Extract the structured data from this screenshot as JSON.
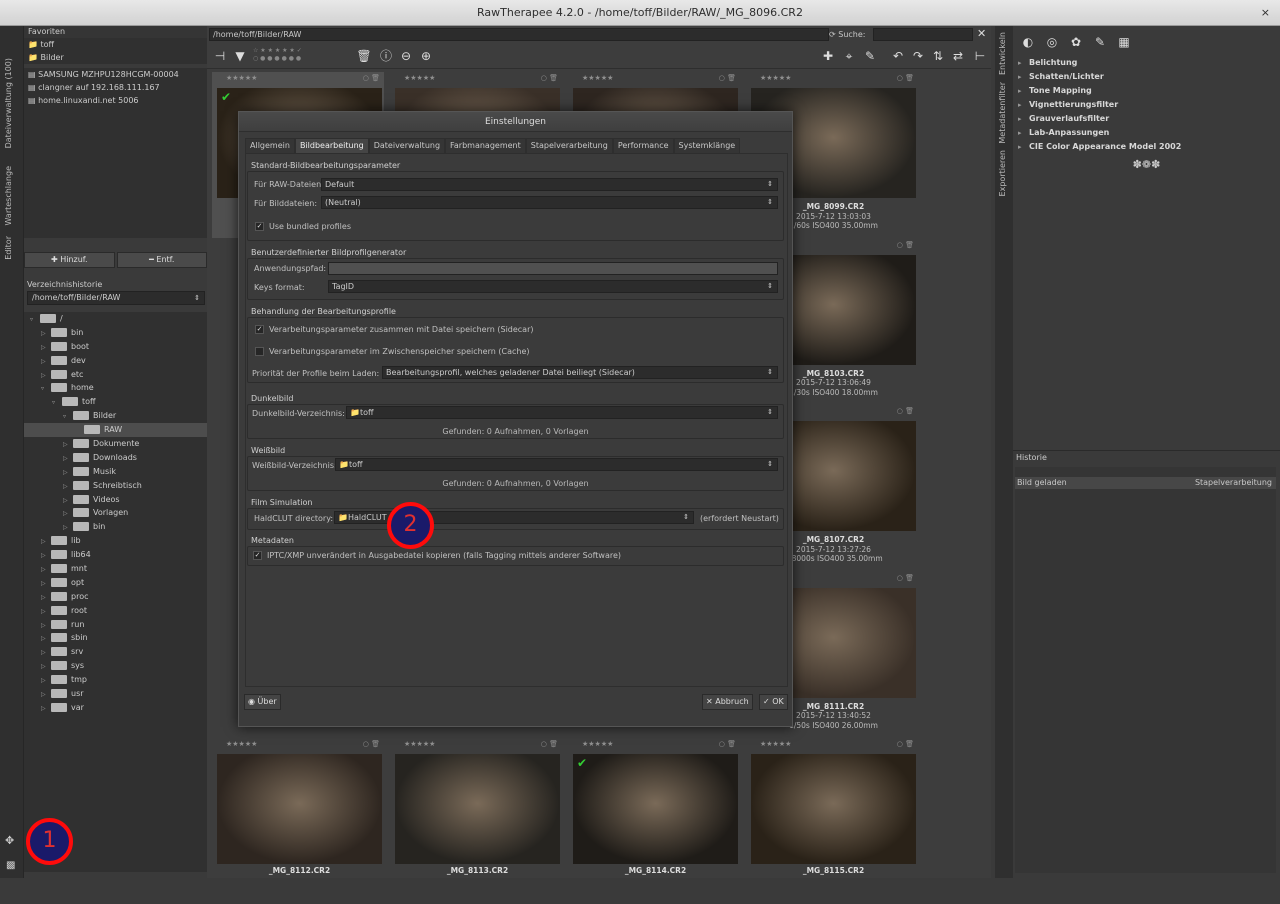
{
  "window": {
    "title": "RawTherapee 4.2.0 - /home/toff/Bilder/RAW/_MG_8096.CR2",
    "close_glyph": "×"
  },
  "left_vtabs": {
    "file_browser": "Dateiverwaltung (100)",
    "queue": "Warteschlange",
    "editor": "Editor"
  },
  "favorites": {
    "title": "Favoriten",
    "items": [
      "toff",
      "Bilder"
    ]
  },
  "places": [
    "SAMSUNG MZHPU128HCGM-00004",
    "clangner auf 192.168.111.167",
    "home.linuxandi.net 5006"
  ],
  "fav_buttons": {
    "add": "Hinzuf.",
    "remove": "Entf."
  },
  "history_dirs": {
    "title": "Verzeichnishistorie",
    "current": "/home/toff/Bilder/RAW"
  },
  "tree": [
    {
      "name": "/",
      "depth": 0,
      "exp": "▿"
    },
    {
      "name": "bin",
      "depth": 1,
      "exp": "▷"
    },
    {
      "name": "boot",
      "depth": 1,
      "exp": "▷"
    },
    {
      "name": "dev",
      "depth": 1,
      "exp": "▷"
    },
    {
      "name": "etc",
      "depth": 1,
      "exp": "▷"
    },
    {
      "name": "home",
      "depth": 1,
      "exp": "▿"
    },
    {
      "name": "toff",
      "depth": 2,
      "exp": "▿"
    },
    {
      "name": "Bilder",
      "depth": 3,
      "exp": "▿"
    },
    {
      "name": "RAW",
      "depth": 4,
      "exp": ""
    },
    {
      "name": "Dokumente",
      "depth": 3,
      "exp": "▷"
    },
    {
      "name": "Downloads",
      "depth": 3,
      "exp": "▷"
    },
    {
      "name": "Musik",
      "depth": 3,
      "exp": "▷"
    },
    {
      "name": "Schreibtisch",
      "depth": 3,
      "exp": "▷"
    },
    {
      "name": "Videos",
      "depth": 3,
      "exp": "▷"
    },
    {
      "name": "Vorlagen",
      "depth": 3,
      "exp": "▷"
    },
    {
      "name": "bin",
      "depth": 3,
      "exp": "▷"
    },
    {
      "name": "lib",
      "depth": 1,
      "exp": "▷"
    },
    {
      "name": "lib64",
      "depth": 1,
      "exp": "▷"
    },
    {
      "name": "mnt",
      "depth": 1,
      "exp": "▷"
    },
    {
      "name": "opt",
      "depth": 1,
      "exp": "▷"
    },
    {
      "name": "proc",
      "depth": 1,
      "exp": "▷"
    },
    {
      "name": "root",
      "depth": 1,
      "exp": "▷"
    },
    {
      "name": "run",
      "depth": 1,
      "exp": "▷"
    },
    {
      "name": "sbin",
      "depth": 1,
      "exp": "▷"
    },
    {
      "name": "srv",
      "depth": 1,
      "exp": "▷"
    },
    {
      "name": "sys",
      "depth": 1,
      "exp": "▷"
    },
    {
      "name": "tmp",
      "depth": 1,
      "exp": "▷"
    },
    {
      "name": "usr",
      "depth": 1,
      "exp": "▷"
    },
    {
      "name": "var",
      "depth": 1,
      "exp": "▷"
    }
  ],
  "browser": {
    "path": "/home/toff/Bilder/RAW",
    "search_label": "Suche:",
    "stars": "★★★★★"
  },
  "thumbs": [
    {
      "name": "",
      "l1": "",
      "l2": "",
      "col": 0,
      "row": 0,
      "check": true
    },
    {
      "name": "",
      "l1": "",
      "l2": "",
      "col": 1,
      "row": 0,
      "check": false
    },
    {
      "name": "",
      "l1": "",
      "l2": "",
      "col": 2,
      "row": 0,
      "check": false
    },
    {
      "name": "_MG_8099.CR2",
      "l1": "2015-7-12 13:03:03",
      "l2": "1/60s ISO400 35.00mm",
      "col": 3,
      "row": 0,
      "check": false
    },
    {
      "name": "_MG_8103.CR2",
      "l1": "2015-7-12 13:06:49",
      "l2": "1/30s ISO400 18.00mm",
      "col": 3,
      "row": 1,
      "check": false
    },
    {
      "name": "_MG_8107.CR2",
      "l1": "2015-7-12 13:27:26",
      "l2": "1/8000s ISO400 35.00mm",
      "col": 3,
      "row": 2,
      "check": false
    },
    {
      "name": "_MG_8111.CR2",
      "l1": "2015-7-12 13:40:52",
      "l2": "1/50s ISO400 26.00mm",
      "col": 3,
      "row": 3,
      "check": false
    },
    {
      "name": "_MG_8112.CR2",
      "l1": "",
      "l2": "",
      "col": 0,
      "row": 4,
      "check": false
    },
    {
      "name": "_MG_8113.CR2",
      "l1": "",
      "l2": "",
      "col": 1,
      "row": 4,
      "check": false
    },
    {
      "name": "_MG_8114.CR2",
      "l1": "",
      "l2": "",
      "col": 2,
      "row": 4,
      "check": true
    },
    {
      "name": "_MG_8115.CR2",
      "l1": "",
      "l2": "",
      "col": 3,
      "row": 4,
      "check": false
    }
  ],
  "right_vtabs": {
    "develop": "Entwickeln",
    "metadata": "Metadatenfilter",
    "export": "Exportieren"
  },
  "tools": [
    "Belichtung",
    "Schatten/Lichter",
    "Tone Mapping",
    "Vignettierungsfilter",
    "Grauverlaufsfilter",
    "Lab-Anpassungen",
    "CIE Color Appearance Model 2002"
  ],
  "history": {
    "title": "Historie",
    "row_left": "Bild geladen",
    "row_right": "Stapelverarbeitung"
  },
  "dialog": {
    "title": "Einstellungen",
    "tabs": [
      "Allgemein",
      "Bildbearbeitung",
      "Dateiverwaltung",
      "Farbmanagement",
      "Stapelverarbeitung",
      "Performance",
      "Systemklänge"
    ],
    "s1": {
      "title": "Standard-Bildbearbeitungsparameter",
      "raw_label": "Für RAW-Dateien:",
      "raw_value": "Default",
      "img_label": "Für Bilddateien:",
      "img_value": "(Neutral)",
      "bundled": "Use bundled profiles"
    },
    "s2": {
      "title": "Benutzerdefinierter Bildprofilgenerator",
      "app_label": "Anwendungspfad:",
      "keys_label": "Keys format:",
      "keys_value": "TagID"
    },
    "s3": {
      "title": "Behandlung der Bearbeitungsprofile",
      "sidecar": "Verarbeitungsparameter zusammen mit Datei speichern (Sidecar)",
      "cache": "Verarbeitungsparameter im Zwischenspeicher speichern (Cache)",
      "prio_label": "Priorität der Profile beim Laden:",
      "prio_value": "Bearbeitungsprofil, welches geladener Datei beiliegt (Sidecar)"
    },
    "s4": {
      "title": "Dunkelbild",
      "dir_label": "Dunkelbild-Verzeichnis:",
      "dir_value": "toff",
      "found": "Gefunden: 0 Aufnahmen, 0 Vorlagen"
    },
    "s5": {
      "title": "Weißbild",
      "dir_label": "Weißbild-Verzeichnis:",
      "dir_value": "toff",
      "found": "Gefunden: 0 Aufnahmen, 0 Vorlagen"
    },
    "s6": {
      "title": "Film Simulation",
      "dir_label": "HaldCLUT directory:",
      "dir_value": "HaldCLUT",
      "note": "(erfordert Neustart)"
    },
    "s7": {
      "title": "Metadaten",
      "iptc": "IPTC/XMP unverändert in Ausgabedatei kopieren (falls Tagging mittels anderer Software)"
    },
    "about": "Über",
    "cancel": "Abbruch",
    "ok": "OK"
  },
  "markers": {
    "m1": "1",
    "m2": "2"
  }
}
